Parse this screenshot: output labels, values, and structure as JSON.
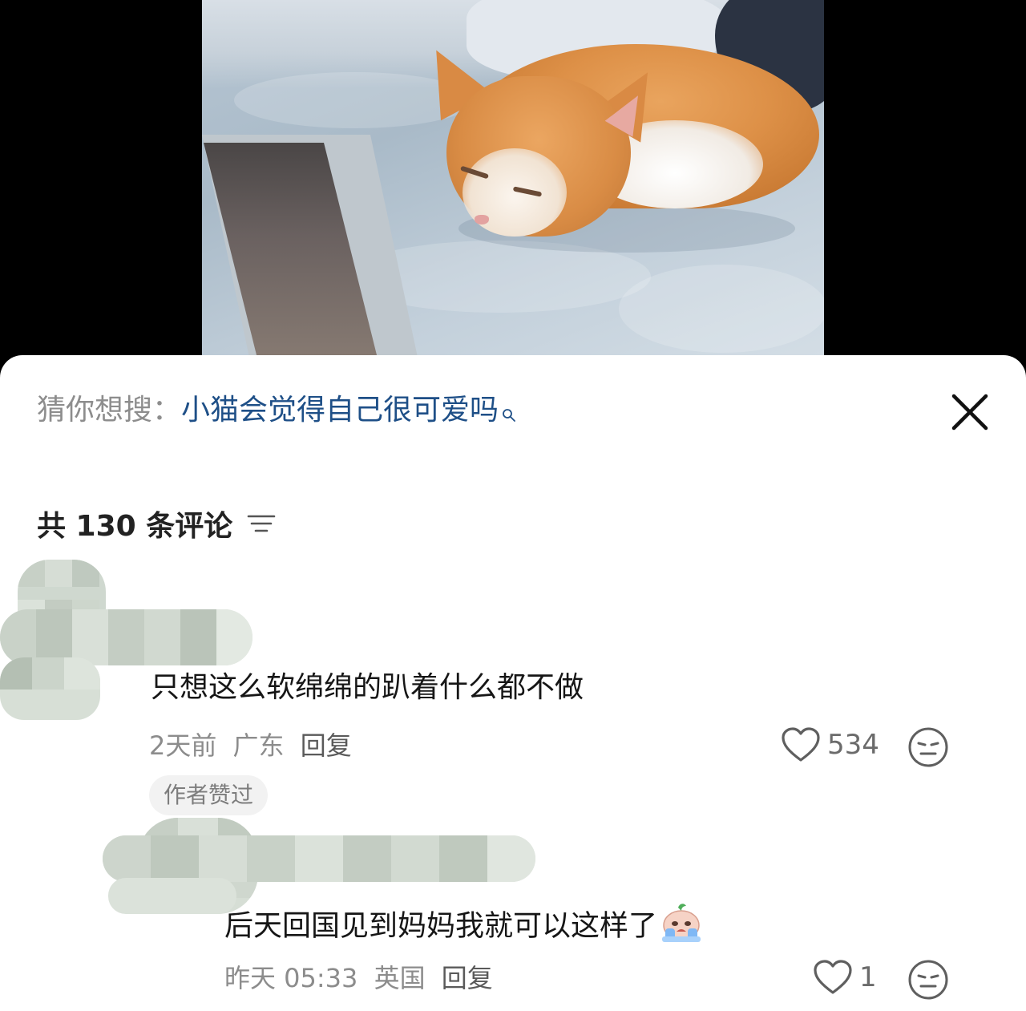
{
  "video": {
    "description_icon": "kitten-video-frame"
  },
  "search_suggestion": {
    "label": "猜你想搜：",
    "query": "小猫会觉得自己很可爱吗",
    "icon": "search-icon"
  },
  "comments_header": {
    "count_text": "共 130 条评论",
    "sort_icon": "sort-icon"
  },
  "comments": [
    {
      "text": "只想这么软绵绵的趴着什么都不做",
      "time": "2天前",
      "location": "广东",
      "reply_label": "回复",
      "likes": "534",
      "badge": "作者赞过"
    },
    {
      "text": "后天回国见到妈妈我就可以这样了",
      "time": "昨天 05:33",
      "location": "英国",
      "reply_label": "回复",
      "likes": "1",
      "emoji": "crying-emoji"
    }
  ],
  "colors": {
    "query_link": "#1e4f87",
    "muted": "#8c8c8c",
    "text": "#161616"
  }
}
